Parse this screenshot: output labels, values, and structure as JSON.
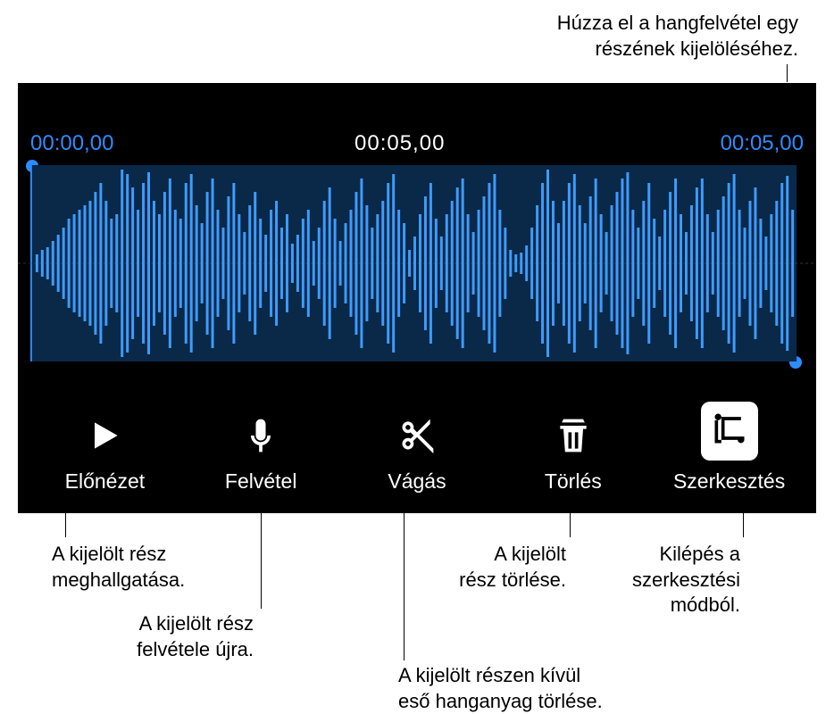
{
  "top_callout": {
    "line1": "Húzza el a hangfelvétel egy",
    "line2": "részének kijelöléséhez."
  },
  "timecodes": {
    "start": "00:00,00",
    "center": "00:05,00",
    "end": "00:05,00"
  },
  "toolbar": {
    "preview": "Előnézet",
    "record": "Felvétel",
    "trim": "Vágás",
    "delete": "Törlés",
    "edit": "Szerkesztés"
  },
  "callouts": {
    "preview": {
      "line1": "A kijelölt rész",
      "line2": "meghallgatása."
    },
    "record": {
      "line1": "A kijelölt rész",
      "line2": "felvétele újra."
    },
    "trim": {
      "line1": "A kijelölt részen kívül",
      "line2": "eső hanganyag törlése."
    },
    "delete": {
      "line1": "A kijelölt",
      "line2": "rész törlése."
    },
    "edit": {
      "line1": "Kilépés a",
      "line2": "szerkesztési",
      "line3": "módból."
    }
  }
}
